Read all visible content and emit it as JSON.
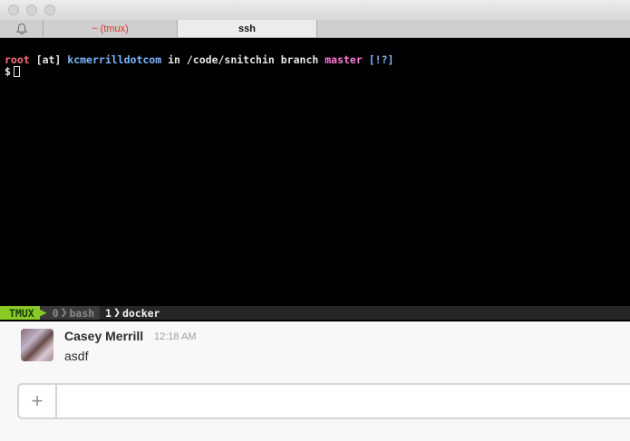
{
  "tabs": {
    "tmux_label": "~ (tmux)",
    "ssh_label": "ssh"
  },
  "terminal": {
    "prompt": {
      "user": "root",
      "at": "[at]",
      "host": "kcmerrilldotcom",
      "in_text": "in",
      "path": "/code/snitchin",
      "branch_text": "branch",
      "branch": "master",
      "status": "[!?]",
      "symbol": "$"
    }
  },
  "statusbar": {
    "session": "TMUX",
    "window0_index": "0",
    "window0_name": "bash",
    "window1_index": "1",
    "window1_name": "docker"
  },
  "message": {
    "sender": "Casey Merrill",
    "timestamp": "12:18 AM",
    "text": "asdf"
  },
  "composer": {
    "plus_label": "+"
  },
  "colors": {
    "tmux_accent": "#8ac926",
    "tmux_tab_red": "#e0332b",
    "prompt_root": "#ff6e7a",
    "prompt_host": "#7db7ff",
    "prompt_branch": "#ff7ad9"
  }
}
